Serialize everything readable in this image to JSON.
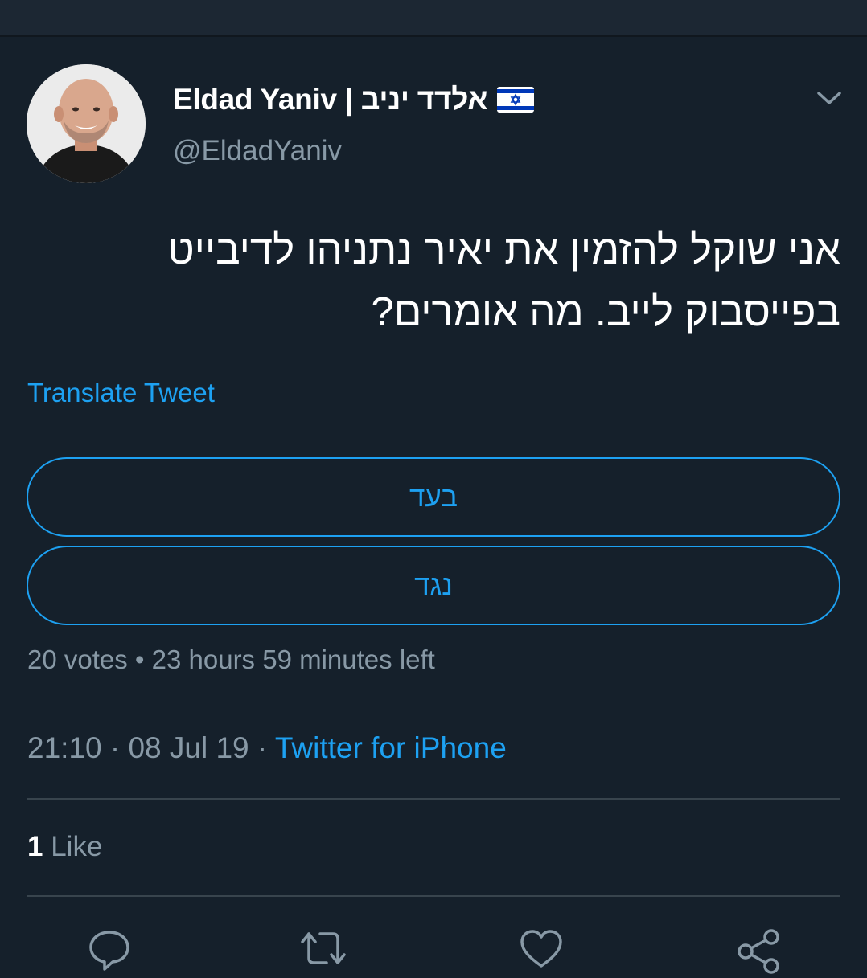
{
  "tweet": {
    "author": {
      "display_name": "Eldad Yaniv | אלדד יניב",
      "handle": "@EldadYaniv",
      "flag_icon": "israel-flag-icon",
      "avatar_icon": "profile-avatar"
    },
    "text_line_1": "אני שוקל להזמין את יאיר נתניהו לדיבייט",
    "text_line_2": "בפייסבוק לייב. מה אומרים?",
    "translate_label": "Translate Tweet",
    "poll": {
      "options": [
        "בעד",
        "נגד"
      ],
      "info": "20 votes • 23 hours 59 minutes left"
    },
    "timestamp": "21:10 · 08 Jul 19 · ",
    "source": "Twitter for iPhone",
    "likes": {
      "count": "1",
      "label": "Like"
    },
    "actions": [
      "reply-icon",
      "retweet-icon",
      "like-icon",
      "share-icon"
    ]
  },
  "colors": {
    "background": "#15202b",
    "accent": "#1da1f2",
    "secondary_text": "#8899a6",
    "divider": "#38444d"
  }
}
